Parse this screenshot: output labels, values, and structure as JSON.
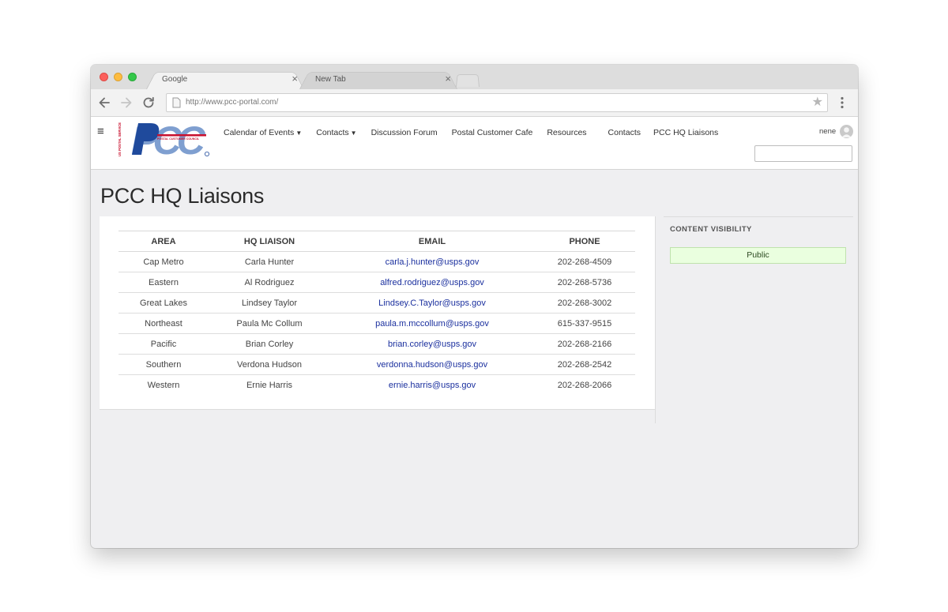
{
  "browser": {
    "tabs": [
      {
        "title": "Google",
        "close": "×"
      },
      {
        "title": "New Tab",
        "close": "×"
      }
    ],
    "url": "http://www.pcc-portal.com/"
  },
  "site": {
    "logo_text": "PCC",
    "nav": [
      {
        "label": "Calendar of Events",
        "dropdown": true
      },
      {
        "label": "Contacts",
        "dropdown": true
      },
      {
        "label": "Discussion Forum",
        "dropdown": false
      },
      {
        "label": "Postal Customer Cafe",
        "dropdown": false
      },
      {
        "label": "Resources",
        "dropdown": false
      },
      {
        "label": "Contacts",
        "dropdown": false
      },
      {
        "label": "PCC HQ Liaisons",
        "dropdown": false
      }
    ],
    "user_name": "nene",
    "search_value": ""
  },
  "page": {
    "title": "PCC HQ Liaisons",
    "table": {
      "headers": [
        "AREA",
        "HQ LIAISON",
        "EMAIL",
        "PHONE"
      ],
      "rows": [
        {
          "area": "Cap Metro",
          "liaison": "Carla Hunter",
          "email": "carla.j.hunter@usps.gov",
          "phone": "202-268-4509"
        },
        {
          "area": "Eastern",
          "liaison": "Al Rodriguez",
          "email": "alfred.rodriguez@usps.gov",
          "phone": "202-268-5736"
        },
        {
          "area": "Great Lakes",
          "liaison": "Lindsey Taylor",
          "email": "Lindsey.C.Taylor@usps.gov",
          "phone": "202-268-3002"
        },
        {
          "area": "Northeast",
          "liaison": "Paula Mc Collum",
          "email": "paula.m.mccollum@usps.gov",
          "phone": "615-337-9515"
        },
        {
          "area": "Pacific",
          "liaison": "Brian Corley",
          "email": "brian.corley@usps.gov",
          "phone": "202-268-2166"
        },
        {
          "area": "Southern",
          "liaison": "Verdona Hudson",
          "email": "verdonna.hudson@usps.gov",
          "phone": "202-268-2542"
        },
        {
          "area": "Western",
          "liaison": "Ernie Harris",
          "email": "ernie.harris@usps.gov",
          "phone": "202-268-2066"
        }
      ]
    }
  },
  "sidebar": {
    "heading": "CONTENT VISIBILITY",
    "visibility": "Public"
  },
  "icons": {
    "back": "arrow-left-icon",
    "forward": "arrow-right-icon",
    "reload": "reload-icon",
    "bookmark": "star-icon",
    "menu": "kebab-menu-icon",
    "hamburger": "hamburger-icon",
    "avatar": "user-avatar-icon"
  },
  "colors": {
    "link": "#1a2f9e",
    "logo_dark_blue": "#1f4a9c",
    "logo_light_blue": "#7f9fd0",
    "visibility_bg": "#eaffdf"
  }
}
